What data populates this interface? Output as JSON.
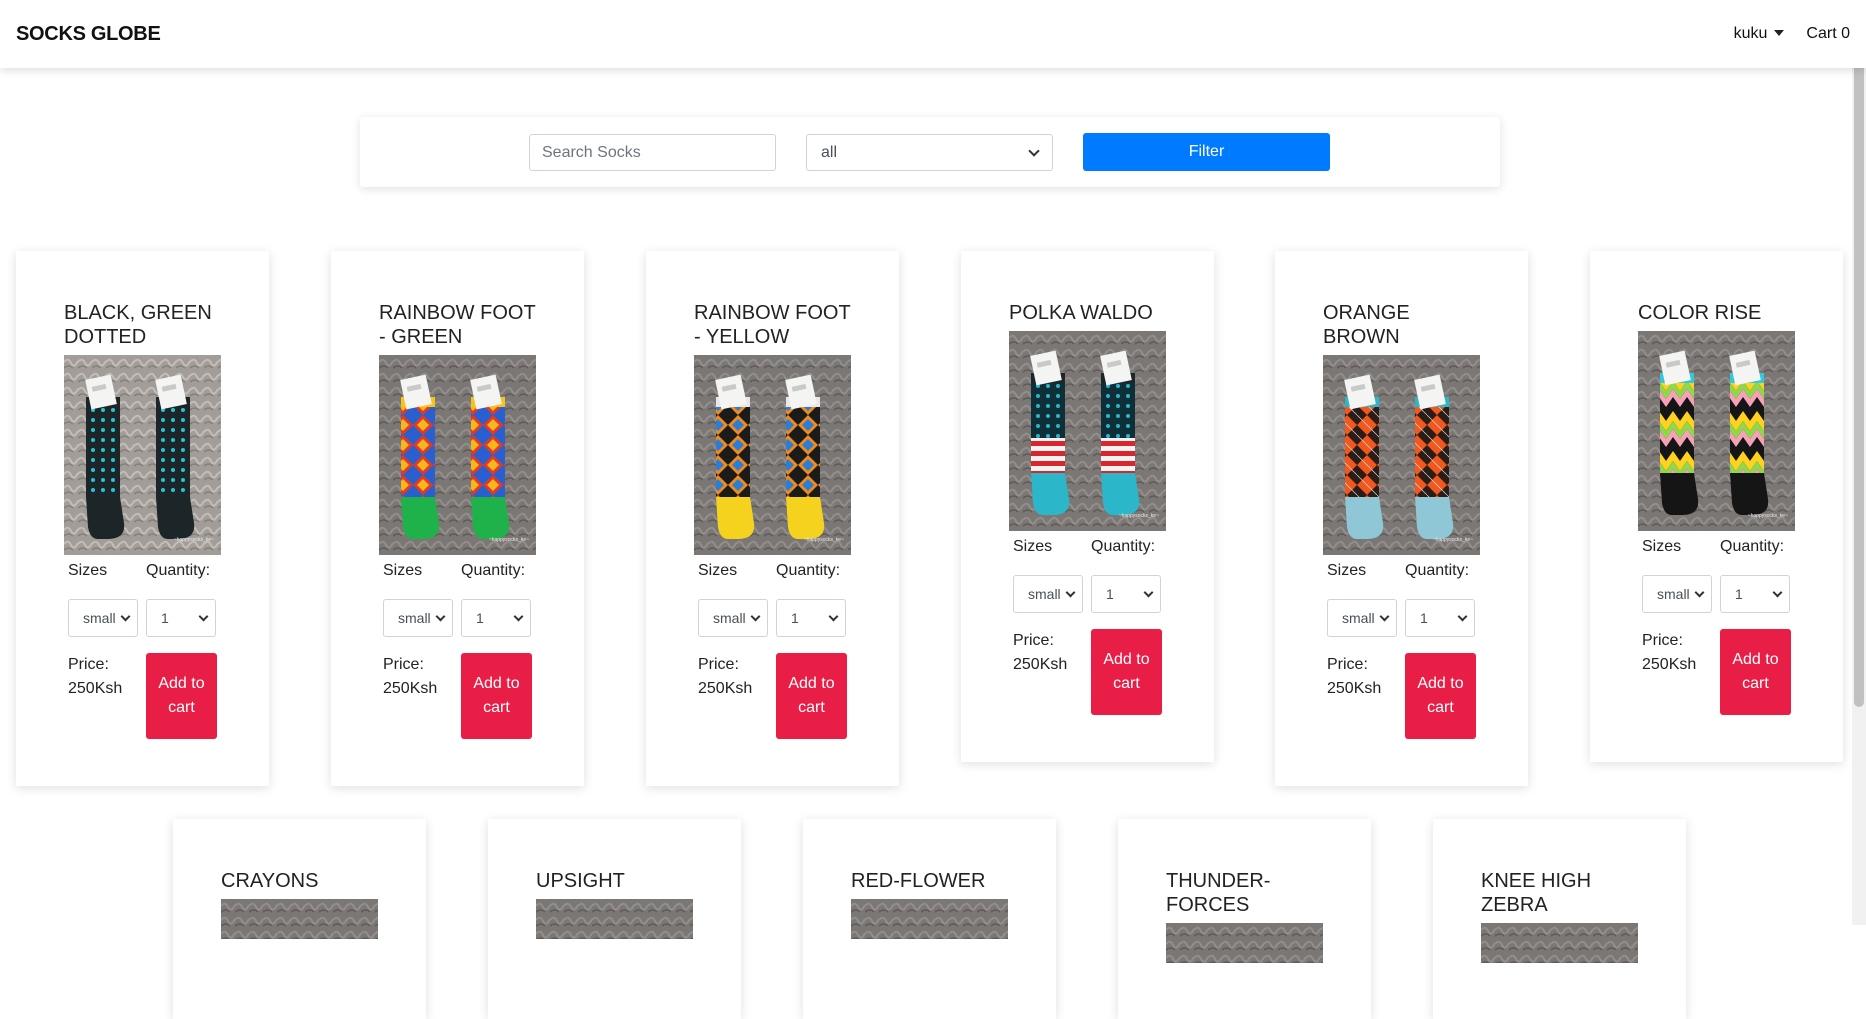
{
  "navbar": {
    "brand": "SOCKS GLOBE",
    "user": "kuku",
    "cart": "Cart 0"
  },
  "filter": {
    "search_placeholder": "Search Socks",
    "category_value": "all",
    "button_label": "Filter"
  },
  "labels": {
    "sizes": "Sizes",
    "quantity": "Quantity:",
    "price": "Price:",
    "add_to_cart": "Add to cart",
    "size_value": "small",
    "quantity_value": "1"
  },
  "products": [
    {
      "name": "BLACK, GREEN DOTTED",
      "price": "250Ksh"
    },
    {
      "name": "RAINBOW FOOT - GREEN",
      "price": "250Ksh"
    },
    {
      "name": "RAINBOW FOOT - YELLOW",
      "price": "250Ksh"
    },
    {
      "name": "POLKA WALDO",
      "price": "250Ksh"
    },
    {
      "name": "ORANGE BROWN",
      "price": "250Ksh"
    },
    {
      "name": "COLOR RISE",
      "price": "250Ksh"
    },
    {
      "name": "CRAYONS"
    },
    {
      "name": "UPSIGHT"
    },
    {
      "name": "RED-FLOWER"
    },
    {
      "name": "THUNDER-FORCES"
    },
    {
      "name": "KNEE HIGH ZEBRA"
    }
  ]
}
